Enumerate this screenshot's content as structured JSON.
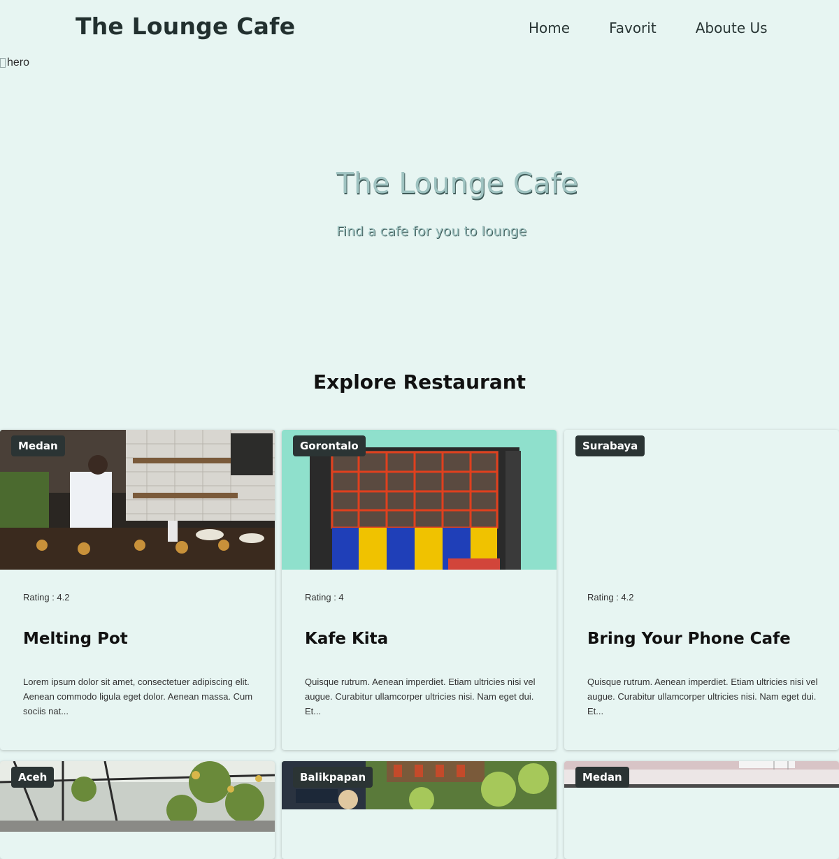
{
  "header": {
    "brand": "The Lounge Cafe",
    "nav": [
      "Home",
      "Favorit",
      "Aboute Us"
    ]
  },
  "hero": {
    "image_alt": "hero",
    "title": "The Lounge Cafe",
    "subtitle": "Find a cafe for you to lounge"
  },
  "section_title": "Explore Restaurant",
  "restaurants": [
    {
      "city": "Medan",
      "rating": "Rating : 4.2",
      "name": "Melting Pot",
      "description": "Lorem ipsum dolor sit amet, consectetuer adipiscing elit. Aenean commodo ligula eget dolor. Aenean massa. Cum sociis nat..."
    },
    {
      "city": "Gorontalo",
      "rating": "Rating : 4",
      "name": "Kafe Kita",
      "description": "Quisque rutrum. Aenean imperdiet. Etiam ultricies nisi vel augue. Curabitur ullamcorper ultricies nisi. Nam eget dui. Et..."
    },
    {
      "city": "Surabaya",
      "rating": "Rating : 4.2",
      "name": "Bring Your Phone Cafe",
      "description": "Quisque rutrum. Aenean imperdiet. Etiam ultricies nisi vel augue. Curabitur ullamcorper ultricies nisi. Nam eget dui. Et..."
    },
    {
      "city": "Aceh"
    },
    {
      "city": "Balikpapan"
    },
    {
      "city": "Medan"
    }
  ],
  "colors": {
    "background": "#e7f5f2",
    "badge": "#2b3434",
    "hero_text": "#9fc3c1"
  }
}
